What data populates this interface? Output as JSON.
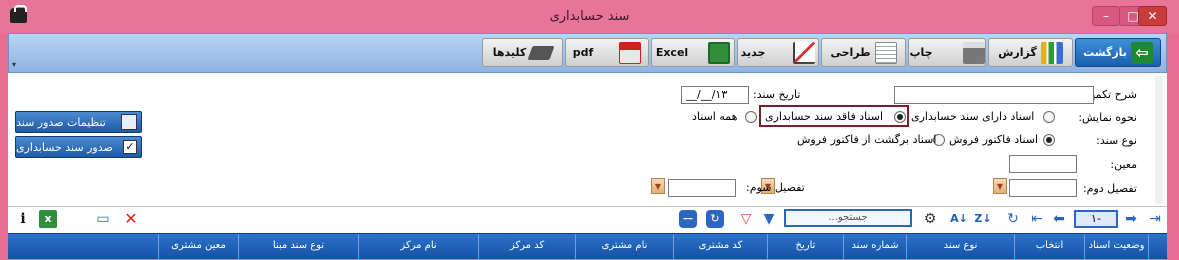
{
  "window": {
    "title": "سند حسابداری"
  },
  "toolbar": {
    "buttons": [
      {
        "label": "بازگشت",
        "icon": "back-arrow-icon"
      },
      {
        "label": "گزارش",
        "icon": "bar-chart-icon"
      },
      {
        "label": "چاپ",
        "icon": "printer-icon"
      },
      {
        "label": "طراحی",
        "icon": "design-icon"
      },
      {
        "label": "جدید",
        "icon": "line-chart-icon"
      },
      {
        "label": "Excel",
        "icon": "excel-icon"
      },
      {
        "label": "pdf",
        "icon": "pdf-icon"
      },
      {
        "label": "کلیدها",
        "icon": "keyboard-icon"
      }
    ]
  },
  "form": {
    "extra_desc_label": "شرح تکمیلی:",
    "doc_date_label": "تاریخ سند:",
    "doc_date_value": "__/__/۱۳",
    "display_mode_label": "نحوه نمایش:",
    "display_options": [
      "اسناد دارای سند حسابداری",
      "اسناد فاقد سند حسابداری",
      "همه اسناد"
    ],
    "display_selected": 1,
    "doc_type_label": "نوع سند:",
    "doc_type_options": [
      "اسناد فاکتور فروش",
      "اسناد برگشت از فاکتور فروش"
    ],
    "doc_type_selected": 0,
    "moein_label": "معین:",
    "tafsil2_label": "تفصیل دوم:",
    "tafsil3_label": "تفصیل سوم:"
  },
  "side_buttons": [
    {
      "label": "تنظیمات صدور سند"
    },
    {
      "label": "صدور سند حسابداری"
    }
  ],
  "navigator": {
    "page_value": "۱-",
    "search_placeholder": "...جستجو"
  },
  "grid": {
    "columns": [
      "وضعیت اسناد",
      "انتخاب",
      "نوع سند",
      "شماره سند",
      "تاریخ",
      "کد مشتری",
      "نام مشتری",
      "کد مرکز",
      "نام مرکز",
      "نوع سند مبنا",
      "معین مشتری"
    ]
  },
  "colors": {
    "window": "#e76d95",
    "toolbar": "#a6c4ec",
    "grid_header": "#1f63b8",
    "highlight_box": "#7a1f2a"
  }
}
